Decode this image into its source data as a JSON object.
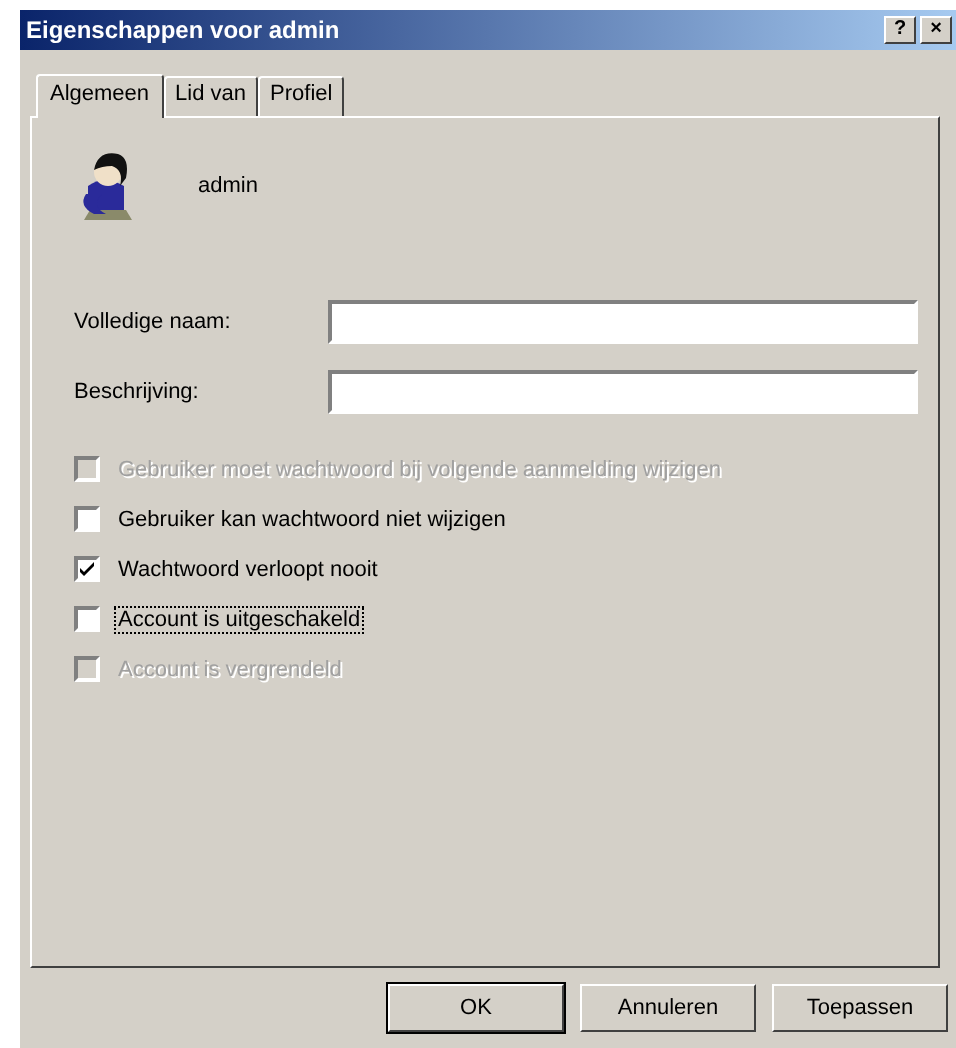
{
  "window": {
    "title": "Eigenschappen voor admin",
    "help_button": "?",
    "close_button": "×"
  },
  "tabs": [
    {
      "label": "Algemeen",
      "selected": true
    },
    {
      "label": "Lid van",
      "selected": false
    },
    {
      "label": "Profiel",
      "selected": false
    }
  ],
  "user": {
    "name": "admin"
  },
  "fields": [
    {
      "label": "Volledige naam:"
    },
    {
      "label": "Beschrijving:"
    }
  ],
  "options": [
    {
      "label": "Gebruiker moet wachtwoord bij volgende aanmelding wijzigen",
      "checked": false,
      "disabled": true,
      "focused": false
    },
    {
      "label": "Gebruiker kan wachtwoord niet wijzigen",
      "checked": false,
      "disabled": false,
      "focused": false
    },
    {
      "label": "Wachtwoord verloopt nooit",
      "checked": true,
      "disabled": false,
      "focused": false
    },
    {
      "label": "Account is uitgeschakeld",
      "checked": false,
      "disabled": false,
      "focused": true
    },
    {
      "label": "Account is vergrendeld",
      "checked": false,
      "disabled": true,
      "focused": false
    }
  ],
  "buttons": [
    {
      "label": "OK",
      "default": true
    },
    {
      "label": "Annuleren",
      "default": false
    },
    {
      "label": "Toepassen",
      "default": false
    }
  ]
}
